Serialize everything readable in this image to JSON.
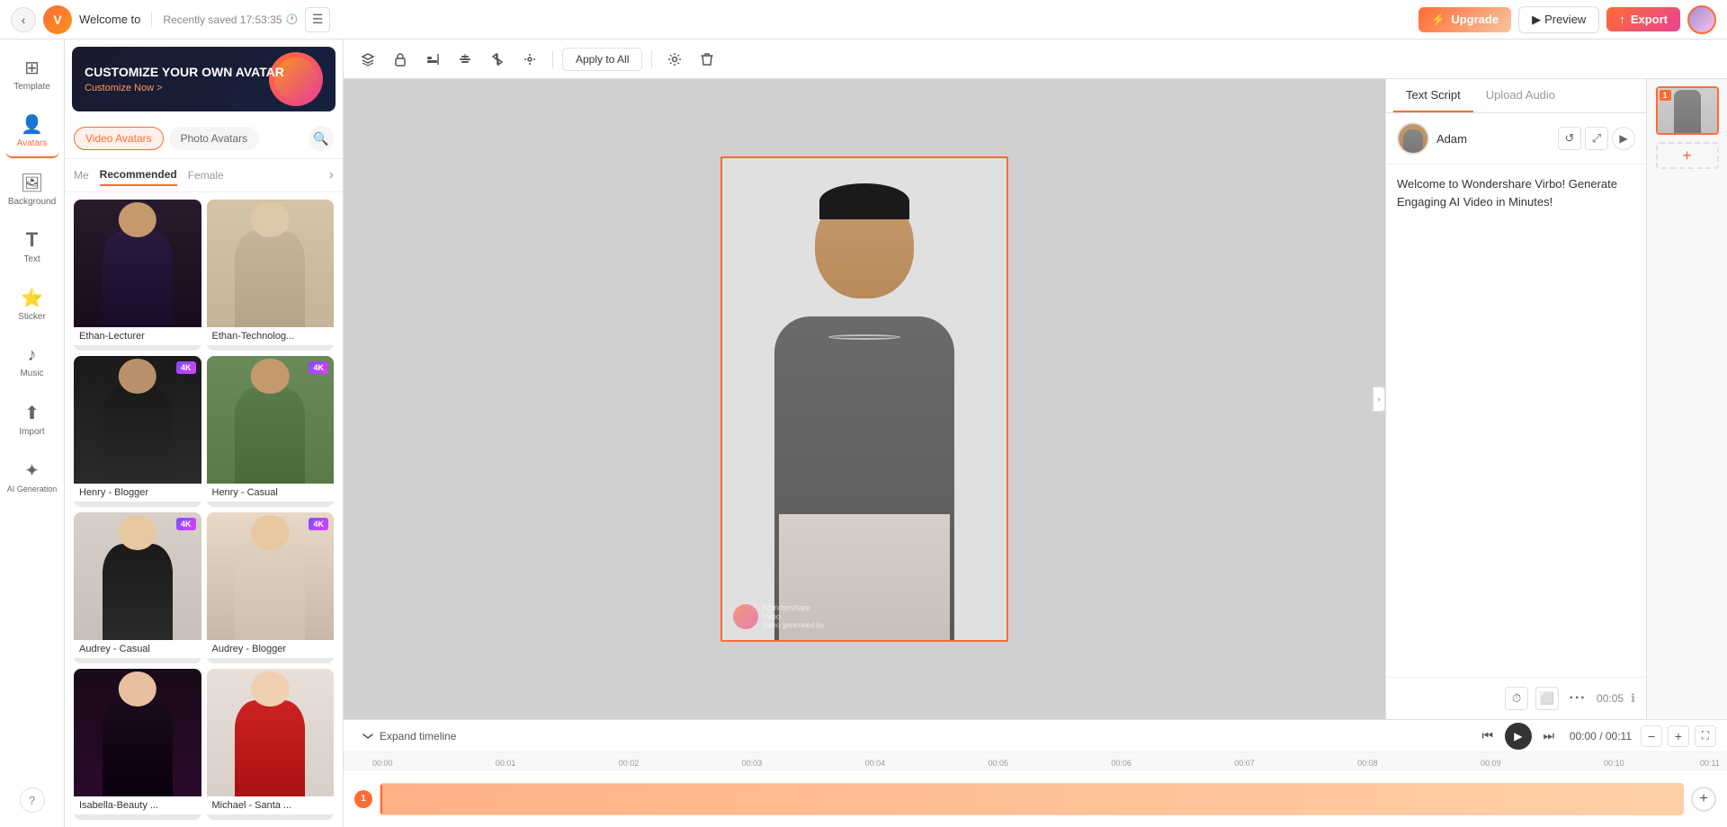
{
  "app": {
    "title": "Welcome to",
    "save_status": "Recently saved 17:53:35",
    "logo_text": "V"
  },
  "nav": {
    "back_label": "‹",
    "storyboard_icon": "☰",
    "upgrade_label": "Upgrade",
    "preview_label": "▶ Preview",
    "export_label": "↑ Export"
  },
  "sidebar": {
    "items": [
      {
        "id": "template",
        "label": "Template",
        "icon": "⊞"
      },
      {
        "id": "avatars",
        "label": "Avatars",
        "icon": "👤"
      },
      {
        "id": "background",
        "label": "Background",
        "icon": "🖼"
      },
      {
        "id": "text",
        "label": "Text",
        "icon": "T"
      },
      {
        "id": "sticker",
        "label": "Sticker",
        "icon": "⭐"
      },
      {
        "id": "music",
        "label": "Music",
        "icon": "♪"
      },
      {
        "id": "import",
        "label": "Import",
        "icon": "⬆"
      },
      {
        "id": "ai_generation",
        "label": "AI Generation",
        "icon": "✦"
      }
    ],
    "active": "avatars",
    "help_label": "?"
  },
  "panel": {
    "banner": {
      "title": "CUSTOMIZE YOUR OWN AVATAR",
      "link": "Customize Now >"
    },
    "avatar_tabs": [
      {
        "id": "video",
        "label": "Video Avatars"
      },
      {
        "id": "photo",
        "label": "Photo Avatars"
      }
    ],
    "active_avatar_tab": "video",
    "filter_tabs": [
      {
        "id": "me",
        "label": "Me"
      },
      {
        "id": "recommended",
        "label": "Recommended"
      },
      {
        "id": "female",
        "label": "Female"
      }
    ],
    "active_filter": "recommended",
    "avatars": [
      {
        "id": 1,
        "name": "Ethan-Lecturer",
        "bg": "dark",
        "badge": null
      },
      {
        "id": 2,
        "name": "Ethan-Technolog...",
        "bg": "beige",
        "badge": null
      },
      {
        "id": 3,
        "name": "Henry - Blogger",
        "bg": "dark2",
        "badge": "4K"
      },
      {
        "id": 4,
        "name": "Henry - Casual",
        "bg": "green",
        "badge": "4K"
      },
      {
        "id": 5,
        "name": "Audrey - Casual",
        "bg": "light",
        "badge": "4K"
      },
      {
        "id": 6,
        "name": "Audrey - Blogger",
        "bg": "plant",
        "badge": "4K"
      },
      {
        "id": 7,
        "name": "Isabella-Beauty ...",
        "bg": "dark3",
        "badge": null
      },
      {
        "id": 8,
        "name": "Michael - Santa ...",
        "bg": "red",
        "badge": null
      }
    ]
  },
  "toolbar": {
    "apply_all_label": "Apply to All",
    "icons": [
      "layers",
      "lock",
      "align-h",
      "align-center",
      "flip",
      "position"
    ]
  },
  "right_panel": {
    "tabs": [
      {
        "id": "text_script",
        "label": "Text Script"
      },
      {
        "id": "upload_audio",
        "label": "Upload Audio"
      }
    ],
    "active_tab": "text_script",
    "avatar_name": "Adam",
    "script_text": "Welcome to Wondershare Virbo! Generate Engaging AI Video in Minutes!",
    "time": "00:05",
    "add_label": "+"
  },
  "slide_panel": {
    "badge_number": "1",
    "add_label": "+"
  },
  "timeline": {
    "expand_label": "Expand timeline",
    "current_time": "00:00",
    "total_time": "00:11",
    "track_label": "1",
    "zoom_labels": [
      "-",
      "+"
    ],
    "ruler_marks": [
      "00:00",
      "00:01",
      "00:02",
      "00:03",
      "00:04",
      "00:05",
      "00:06",
      "00:07",
      "00:08",
      "00:09",
      "00:10",
      "00:11"
    ]
  }
}
